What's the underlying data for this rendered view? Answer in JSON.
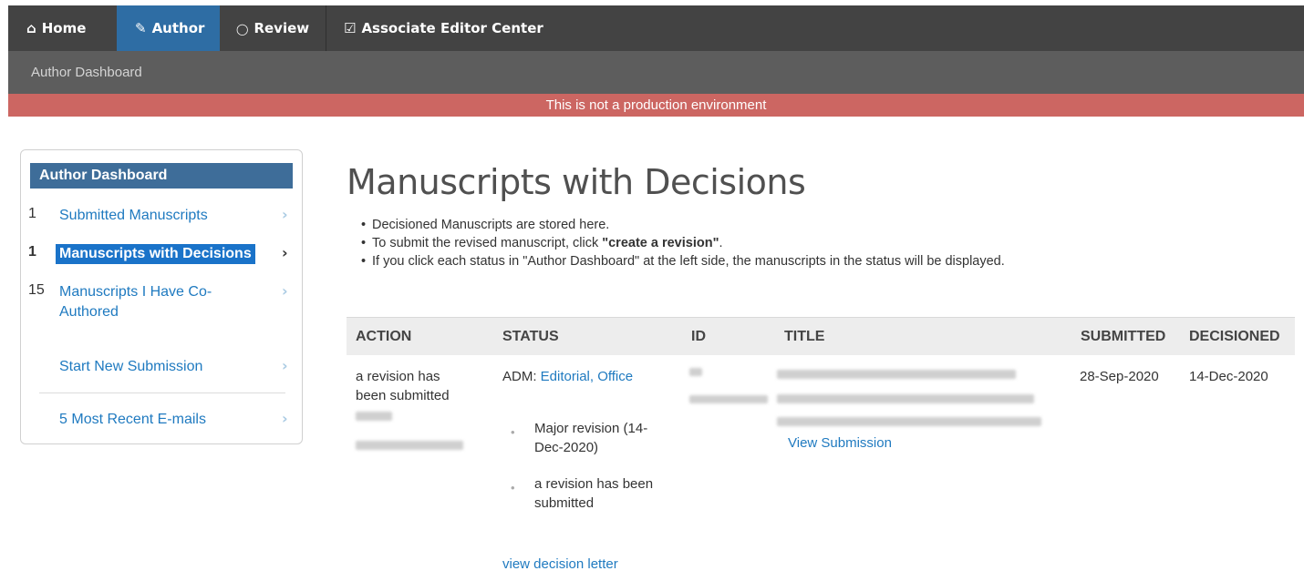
{
  "nav": {
    "items": [
      {
        "icon": "home-icon",
        "glyph": "⌂",
        "label": "Home"
      },
      {
        "icon": "pencil-icon",
        "glyph": "✎",
        "label": "Author"
      },
      {
        "icon": "speech-bubble-icon",
        "glyph": "◯",
        "label": "Review"
      },
      {
        "icon": "checkbox-icon",
        "glyph": "☑",
        "label": "Associate Editor Center"
      }
    ]
  },
  "subnav": {
    "breadcrumb": "Author Dashboard"
  },
  "env_banner": "This is not a production environment",
  "sidebar": {
    "title": "Author Dashboard",
    "items": [
      {
        "count": "1",
        "label": "Submitted Manuscripts"
      },
      {
        "count": "1",
        "label": "Manuscripts with Decisions"
      },
      {
        "count": "15",
        "label": "Manuscripts I Have Co-Authored"
      },
      {
        "count": "",
        "label": "Start New Submission"
      },
      {
        "count": "5",
        "label": "Most Recent E-mails"
      }
    ]
  },
  "main": {
    "title": "Manuscripts with Decisions",
    "bullet1": "Decisioned Manuscripts are stored here.",
    "bullet2_pre": "To submit the revised manuscript, click ",
    "bullet2_bold": "\"create a revision\"",
    "bullet2_post": ".",
    "bullet3": "If you click each status in \"Author Dashboard\" at the left side, the manuscripts in the status will be displayed."
  },
  "table": {
    "headers": {
      "action": "ACTION",
      "status": "STATUS",
      "id": "ID",
      "title": "TITLE",
      "submitted": "SUBMITTED",
      "decisioned": "DECISIONED"
    },
    "row": {
      "action": "a revision has been submitted",
      "status_prefix": "ADM:",
      "status_link": "Editorial, Office",
      "status_history": [
        "Major revision (14-Dec-2020)",
        "a revision has been submitted"
      ],
      "view_decision_letter": "view decision letter",
      "view_submission": "View Submission",
      "submitted": "28-Sep-2020",
      "decisioned": "14-Dec-2020"
    }
  }
}
